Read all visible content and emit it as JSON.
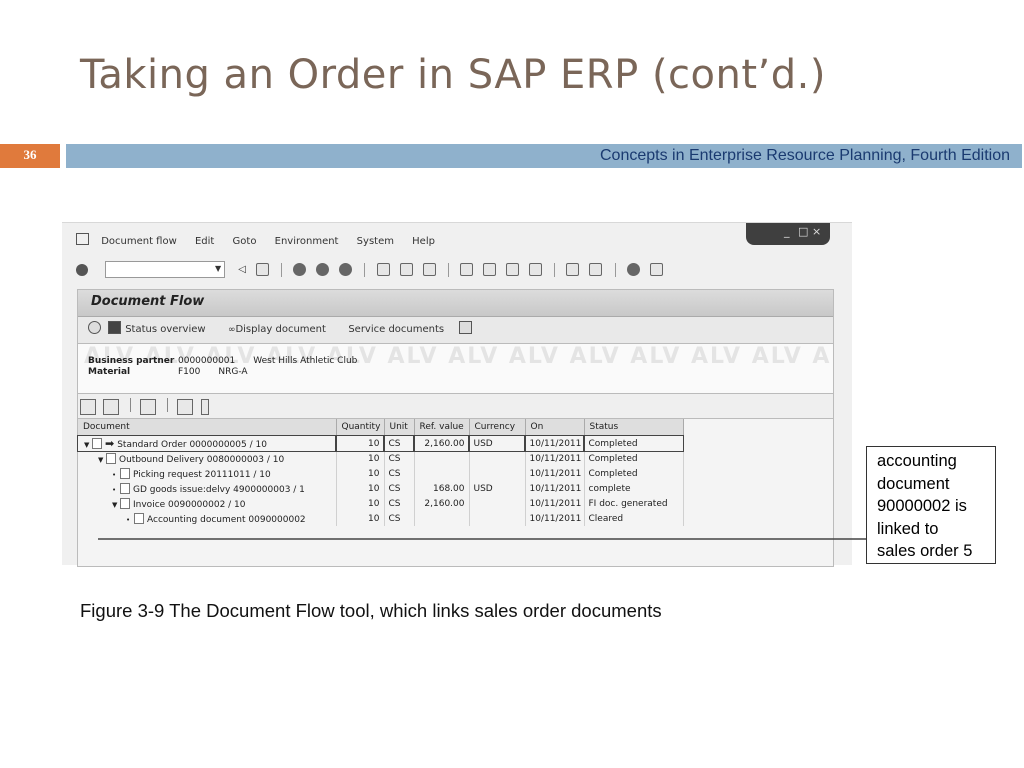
{
  "slide": {
    "title": "Taking an Order in SAP ERP (cont’d.)",
    "page_number": "36",
    "subtitle": "Concepts in Enterprise Resource Planning, Fourth Edition",
    "caption": "Figure 3-9  The Document Flow tool, which links sales order documents"
  },
  "sap": {
    "menu": [
      "Document flow",
      "Edit",
      "Goto",
      "Environment",
      "System",
      "Help"
    ],
    "window_controls": [
      "_",
      "□",
      "×"
    ],
    "panel_title": "Document Flow",
    "app_toolbar": {
      "status_overview": "Status overview",
      "display_document": "Display document",
      "service_documents": "Service documents"
    },
    "watermark": "ALV ALV ALV ALV ALV ALV ALV ALV ALV ALV ALV ALV ALV ALV ALV ALV",
    "business_partner": {
      "label": "Business partner",
      "id": "0000000001",
      "name": "West Hills Athletic Club"
    },
    "material": {
      "label": "Material",
      "id": "F100",
      "name": "NRG-A"
    },
    "columns": [
      "Document",
      "Quantity",
      "Unit",
      "Ref. value",
      "Currency",
      "On",
      "Status"
    ],
    "rows": [
      {
        "toggle": "▼",
        "bullet": "",
        "icon": "arrow",
        "document": "Standard Order 0000000005 / 10",
        "quantity": "10",
        "unit": "CS",
        "ref_value": "2,160.00",
        "currency": "USD",
        "on": "10/11/2011",
        "status": "Completed"
      },
      {
        "toggle": "▼",
        "bullet": "",
        "icon": "doc",
        "document": "Outbound Delivery 0080000003 / 10",
        "quantity": "10",
        "unit": "CS",
        "ref_value": "",
        "currency": "",
        "on": "10/11/2011",
        "status": "Completed"
      },
      {
        "toggle": "",
        "bullet": "•",
        "icon": "doc",
        "document": "Picking request 20111011 / 10",
        "quantity": "10",
        "unit": "CS",
        "ref_value": "",
        "currency": "",
        "on": "10/11/2011",
        "status": "Completed"
      },
      {
        "toggle": "",
        "bullet": "•",
        "icon": "doc",
        "document": "GD goods issue:delvy 4900000003 / 1",
        "quantity": "10",
        "unit": "CS",
        "ref_value": "168.00",
        "currency": "USD",
        "on": "10/11/2011",
        "status": "complete"
      },
      {
        "toggle": "▼",
        "bullet": "",
        "icon": "doc",
        "document": "Invoice 0090000002 / 10",
        "quantity": "10",
        "unit": "CS",
        "ref_value": "2,160.00",
        "currency": "",
        "on": "10/11/2011",
        "status": "FI doc. generated"
      },
      {
        "toggle": "",
        "bullet": "•",
        "icon": "doc",
        "document": "Accounting document 0090000002",
        "quantity": "10",
        "unit": "CS",
        "ref_value": "",
        "currency": "",
        "on": "10/11/2011",
        "status": "Cleared"
      }
    ]
  },
  "callout_lines": [
    "accounting",
    "document",
    "90000002 is",
    "linked to",
    "sales order 5"
  ]
}
